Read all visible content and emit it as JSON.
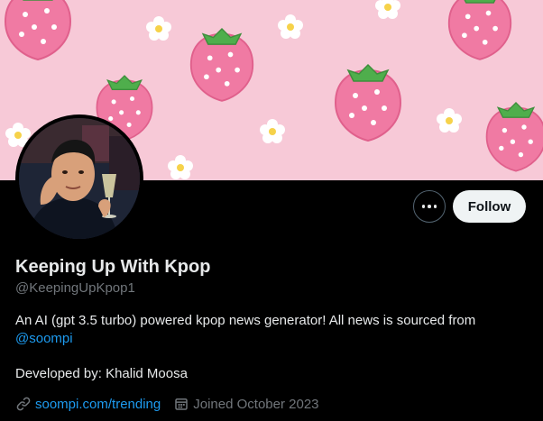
{
  "profile": {
    "display_name": "Keeping Up With Kpop",
    "handle": "@KeepingUpKpop1",
    "bio_text": "An AI (gpt 3.5 turbo) powered kpop news generator! All news is sourced from ",
    "bio_mention": "@soompi",
    "developer_line": "Developed by: Khalid Moosa",
    "website": "soompi.com/trending",
    "joined": "Joined October 2023"
  },
  "actions": {
    "follow_label": "Follow"
  },
  "icons": {
    "more": "more-horizontal-icon",
    "link": "link-icon",
    "calendar": "calendar-icon"
  },
  "colors": {
    "accent": "#1d9bf0",
    "banner_bg": "#f7c9d7",
    "strawberry": "#f07aa3",
    "follow_bg": "#eff3f4"
  }
}
